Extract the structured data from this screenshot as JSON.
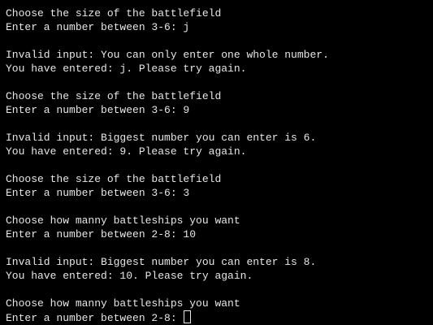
{
  "terminal": {
    "lines": [
      "Choose the size of the battlefield",
      "Enter a number between 3-6: j",
      "",
      "Invalid input: You can only enter one whole number.",
      "You have entered: j. Please try again.",
      "",
      "Choose the size of the battlefield",
      "Enter a number between 3-6: 9",
      "",
      "Invalid input: Biggest number you can enter is 6.",
      "You have entered: 9. Please try again.",
      "",
      "Choose the size of the battlefield",
      "Enter a number between 3-6: 3",
      "",
      "Choose how manny battleships you want",
      "Enter a number between 2-8: 10",
      "",
      "Invalid input: Biggest number you can enter is 8.",
      "You have entered: 10. Please try again.",
      "",
      "Choose how manny battleships you want",
      "Enter a number between 2-8: "
    ]
  },
  "colors": {
    "background": "#000000",
    "text": "#e6e6e6"
  }
}
